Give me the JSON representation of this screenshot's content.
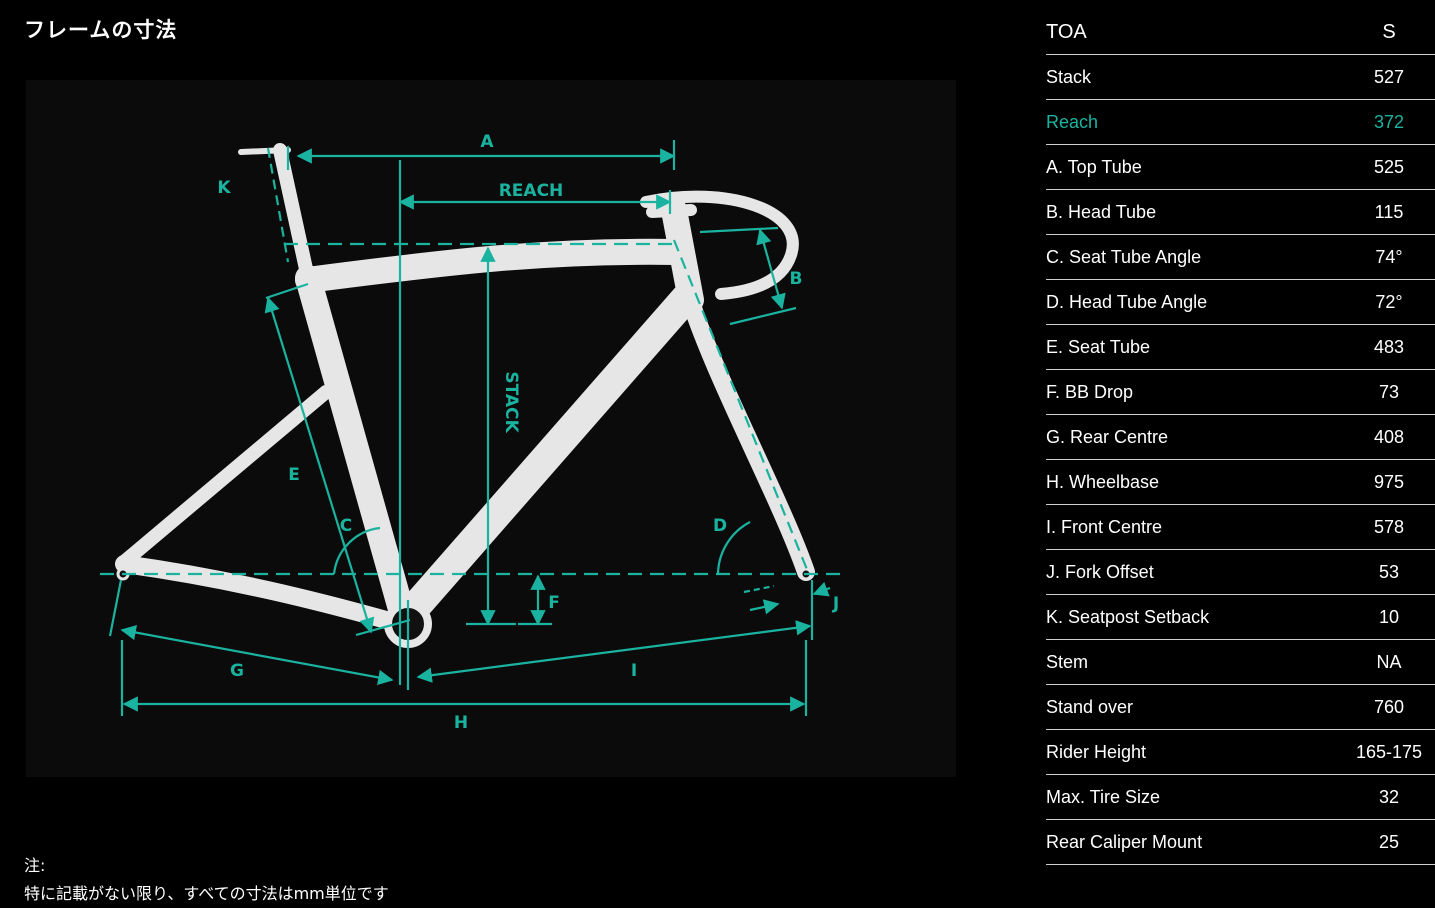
{
  "page": {
    "title": "フレームの寸法"
  },
  "notes": {
    "heading": "注:",
    "body": "特に記載がない限り、すべての寸法はmm単位です"
  },
  "colors": {
    "accent": "#1ab3a0",
    "background": "#000000",
    "frame": "#e8e8e8"
  },
  "diagram": {
    "labels": {
      "a": "A",
      "reach": "REACH",
      "b": "B",
      "k": "K",
      "stack": "STACK",
      "e": "E",
      "c": "C",
      "d": "D",
      "f": "F",
      "j": "J",
      "g": "G",
      "i": "I",
      "h": "H"
    }
  },
  "table": {
    "header": {
      "name": "TOA",
      "size": "S"
    },
    "rows": [
      {
        "name": "Stack",
        "value": "527"
      },
      {
        "name": "Reach",
        "value": "372",
        "highlight": true
      },
      {
        "name": "A. Top Tube",
        "value": "525"
      },
      {
        "name": "B. Head Tube",
        "value": "115"
      },
      {
        "name": "C. Seat Tube Angle",
        "value": "74°"
      },
      {
        "name": "D. Head Tube Angle",
        "value": "72°"
      },
      {
        "name": "E. Seat Tube",
        "value": "483"
      },
      {
        "name": "F. BB Drop",
        "value": "73"
      },
      {
        "name": "G. Rear Centre",
        "value": "408"
      },
      {
        "name": "H. Wheelbase",
        "value": "975"
      },
      {
        "name": "I. Front Centre",
        "value": "578"
      },
      {
        "name": "J. Fork Offset",
        "value": "53"
      },
      {
        "name": "K. Seatpost Setback",
        "value": "10"
      },
      {
        "name": "Stem",
        "value": "NA"
      },
      {
        "name": "Stand over",
        "value": "760"
      },
      {
        "name": "Rider Height",
        "value": "165-175"
      },
      {
        "name": "Max. Tire Size",
        "value": "32"
      },
      {
        "name": "Rear Caliper Mount",
        "value": "25"
      }
    ]
  }
}
